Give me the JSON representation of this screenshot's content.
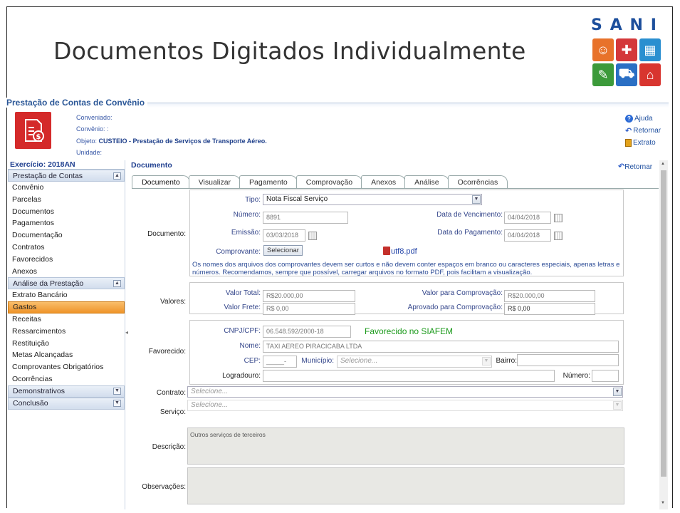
{
  "slide": {
    "title": "Documentos Digitados Individualmente"
  },
  "logo": {
    "text": "SANI"
  },
  "panel": {
    "legend": "Prestação de Contas de Convênio",
    "conveniado_label": "Conveniado:",
    "convenio_label": "Convênio: :",
    "objeto_label": "Objeto:",
    "objeto_value": "CUSTEIO - Prestação de Serviços de Transporte Aéreo.",
    "unidade_label": "Unidade:"
  },
  "toplinks": {
    "help": "Ajuda",
    "back": "Retornar",
    "extract": "Extrato"
  },
  "sidebar": {
    "exercicio": "Exercício: 2018AN",
    "sections": [
      {
        "label": "Prestação de Contas",
        "toggle": "▲",
        "items": [
          "Convênio",
          "Parcelas",
          "Documentos",
          "Pagamentos",
          "Documentação",
          "Contratos",
          "Favorecidos",
          "Anexos"
        ]
      },
      {
        "label": "Análise da Prestação",
        "toggle": "▲",
        "items": [
          "Extrato Bancário",
          "Gastos",
          "Receitas",
          "Ressarcimentos",
          "Restituição",
          "Metas Alcançadas",
          "Comprovantes Obrigatórios",
          "Ocorrências"
        ]
      },
      {
        "label": "Demonstrativos",
        "toggle": "▼",
        "items": []
      },
      {
        "label": "Conclusão",
        "toggle": "▼",
        "items": []
      }
    ]
  },
  "main": {
    "title": "Documento",
    "back": "Retornar",
    "tabs": [
      "Documento",
      "Visualizar",
      "Pagamento",
      "Comprovação",
      "Anexos",
      "Análise",
      "Ocorrências"
    ],
    "active_tab": 0
  },
  "documento": {
    "group_label": "Documento:",
    "tipo_label": "Tipo:",
    "tipo_value": "Nota Fiscal Serviço",
    "numero_label": "Número:",
    "numero_value": "8891",
    "vencimento_label": "Data de Vencimento:",
    "vencimento_value": "04/04/2018",
    "emissao_label": "Emissão:",
    "emissao_value": "03/03/2018",
    "pagamento_label": "Data do Pagamento:",
    "pagamento_value": "04/04/2018",
    "comprovante_label": "Comprovante:",
    "comprovante_button": "Selecionar",
    "file_name": "utf8.pdf",
    "note_line1": "Os nomes dos arquivos dos comprovantes devem ser curtos e não devem conter espaços em branco ou caracteres especiais, apenas letras e",
    "note_line2": "números. Recomendamos, sempre que possível, carregar arquivos no formato PDF, pois facilitam a visualização."
  },
  "valores": {
    "group_label": "Valores:",
    "total_label": "Valor Total:",
    "total_value": "R$20.000,00",
    "comprovacao_label": "Valor para Comprovação:",
    "comprovacao_value": "R$20.000,00",
    "frete_label": "Valor Frete:",
    "frete_value": "R$ 0,00",
    "aprovado_label": "Aprovado para Comprovação:",
    "aprovado_value": "R$ 0,00"
  },
  "favorecido": {
    "group_label": "Favorecido:",
    "cnpj_label": "CNPJ/CPF:",
    "cnpj_value": "06.548.592/2000-18",
    "siafem": "Favorecido no SIAFEM",
    "nome_label": "Nome:",
    "nome_value": "TAXI AEREO PIRACICABA LTDA",
    "cep_label": "CEP:",
    "cep_value": "_____-___",
    "municipio_label": "Município:",
    "municipio_placeholder": "Selecione...",
    "bairro_label": "Bairro:",
    "logradouro_label": "Logradouro:",
    "numero_label": "Número:"
  },
  "contrato": {
    "label": "Contrato:",
    "placeholder": "Selecione..."
  },
  "servico": {
    "label": "Serviço:",
    "placeholder": "Selecione..."
  },
  "descricao": {
    "label": "Descrição:",
    "value": "Outros serviços de terceiros"
  },
  "observacoes": {
    "label": "Observações:",
    "value": ""
  }
}
